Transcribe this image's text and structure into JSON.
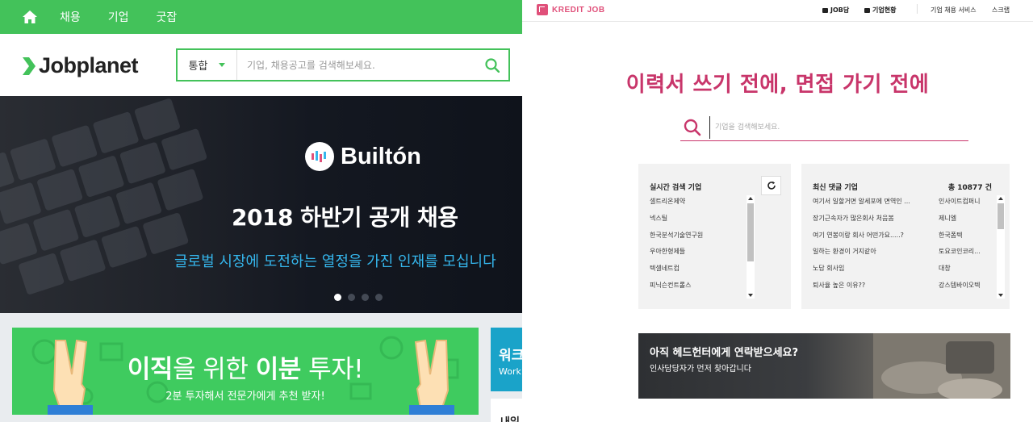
{
  "jobplanet": {
    "nav": {
      "items": [
        "채용",
        "기업",
        "굿잡"
      ]
    },
    "logo": {
      "text": "Jobplanet"
    },
    "search": {
      "category": "통합",
      "placeholder": "기업, 채용공고를 검색해보세요."
    },
    "banner": {
      "brand": "Builtón",
      "title": "2018 하반기 공개 채용",
      "subtitle": "글로벌 시장에 도전하는 열정을 가진 인재를 모십니다",
      "slide_count": 4,
      "active_slide": 1
    },
    "ad": {
      "title_part1": "이직",
      "title_part2": "을 위한 ",
      "title_part3": "이분",
      "title_part4": " 투자!",
      "subtitle": "2분 투자해서 전문가에게 추천 받자!"
    },
    "ad2": {
      "title": "워크",
      "subtitle": "Work"
    },
    "ad3": {
      "text": "내일"
    }
  },
  "kreditjob": {
    "logo": {
      "text": "KREDIT JOB"
    },
    "nav": {
      "job_talk": "JOB담",
      "company_status": "기업현황",
      "services": "기업 채용 서비스",
      "scrap": "스크랩"
    },
    "hero": "이력서 쓰기 전에, 면접 가기 전에",
    "search": {
      "placeholder": "기업을 검색해보세요."
    },
    "realtime": {
      "title": "실시간 검색 기업",
      "items": [
        "셀트리온제약",
        "넥스틸",
        "한국분석기술연구원",
        "우아한형제들",
        "텍셀네트컴",
        "피닉슨컨트롤스"
      ]
    },
    "comments": {
      "title": "최신 댓글 기업",
      "count": "총 10877 건",
      "items": [
        {
          "q": "여기서 일할거면 알세포에 면역인 ...",
          "company": "인사이트컴퍼니"
        },
        {
          "q": "장기근속자가 많은회사 처음봄",
          "company": "제니엘"
        },
        {
          "q": "여기 연봉이랑 회사 어떤가요.....?",
          "company": "한국폼텍"
        },
        {
          "q": "일하는 환경이 거지같아",
          "company": "토요코인코리..."
        },
        {
          "q": "노답 회사임",
          "company": "대창"
        },
        {
          "q": "퇴사율 높은 이유??",
          "company": "강스템바이오텍"
        }
      ]
    },
    "headhunter": {
      "title": "아직 헤드헌터에게 연락받으세요?",
      "subtitle": "인사담당자가 먼저 찾아갑니다"
    }
  },
  "colors": {
    "jobplanet_green": "#43c25a",
    "kreditjob_pink": "#c8356a",
    "banner_sub": "#35b6ec"
  }
}
